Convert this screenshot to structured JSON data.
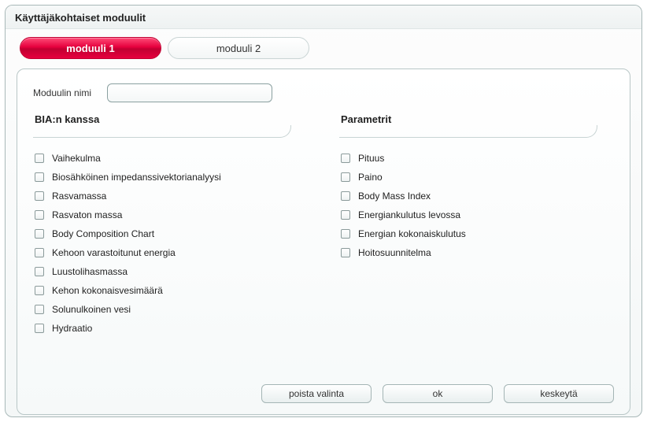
{
  "dialog": {
    "title": "Käyttäjäkohtaiset moduulit"
  },
  "tabs": {
    "tab1": "moduuli 1",
    "tab2": "moduuli 2"
  },
  "nameRow": {
    "label": "Moduulin nimi",
    "value": ""
  },
  "left": {
    "header": "BIA:n kanssa",
    "items": [
      "Vaihekulma",
      "Biosähköinen impedanssivektorianalyysi",
      "Rasvamassa",
      "Rasvaton massa",
      "Body Composition Chart",
      "Kehoon varastoitunut energia",
      "Luustolihasmassa",
      "Kehon kokonaisvesimäärä",
      "Solunulkoinen vesi",
      "Hydraatio"
    ]
  },
  "right": {
    "header": "Parametrit",
    "items": [
      "Pituus",
      "Paino",
      "Body Mass Index",
      "Energiankulutus levossa",
      "Energian kokonaiskulutus",
      "Hoitosuunnitelma"
    ]
  },
  "buttons": {
    "clear": "poista valinta",
    "ok": "ok",
    "cancel": "keskeytä"
  }
}
